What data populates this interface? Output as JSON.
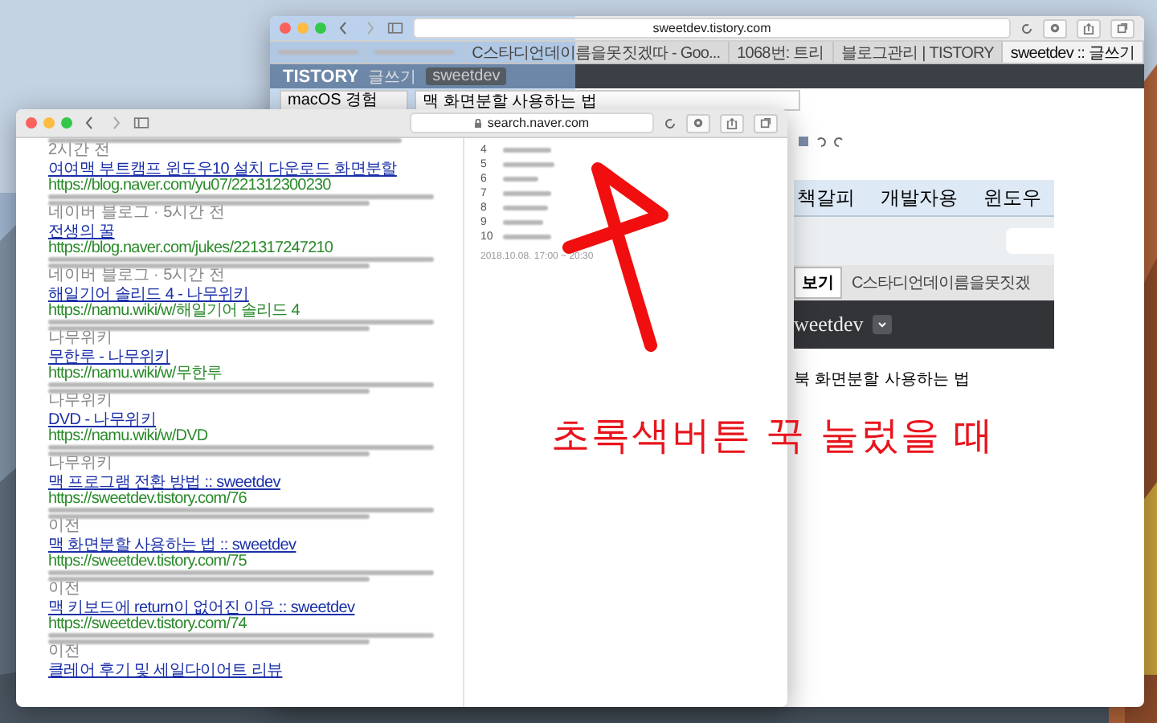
{
  "back_window": {
    "url": "sweetdev.tistory.com",
    "tabs": [
      {
        "selected": false
      },
      {
        "selected": false
      },
      {
        "label": "C스타디언데이름을못짓겠따 - Goo...",
        "selected": false
      },
      {
        "label": "1068번: 트리",
        "selected": false
      },
      {
        "label": "블로그관리 | TISTORY",
        "selected": false
      },
      {
        "label": "sweetdev :: 글쓰기",
        "selected": true
      }
    ],
    "blog_bar": {
      "logo": "TISTORY",
      "section": "글쓰기",
      "blog_chip": "sweetdev"
    },
    "category": "macOS 경험",
    "title_value": "맥 화면분할 사용하는 법",
    "embedded_screenshot": {
      "menu": [
        "책갈피",
        "개발자용",
        "윈도우"
      ],
      "tabs": [
        {
          "label": "보기",
          "selected": true
        },
        {
          "label": "C스타디언데이름을못짓겠",
          "selected": false
        }
      ],
      "blog_name": "weetdev",
      "post_title": "북 화면분할 사용하는 법"
    }
  },
  "front_window": {
    "url": "search.naver.com",
    "results": [
      {
        "source": "2시간 전"
      },
      {
        "title": "여여맥 부트캠프 윈도우10 설치 다운로드 화면분할",
        "url": "https://blog.naver.com/yu07/221312300230",
        "source": "네이버 블로그 · 5시간 전"
      },
      {
        "title": "전생의 꿀",
        "url": "https://blog.naver.com/jukes/221317247210",
        "source": "네이버 블로그 · 5시간 전"
      },
      {
        "title": "해일기어 솔리드 4 - 나무위키",
        "url": "https://namu.wiki/w/해일기어 솔리드 4",
        "source": "나무위키"
      },
      {
        "title": "무한루 - 나무위키",
        "url": "https://namu.wiki/w/무한루",
        "source": "나무위키"
      },
      {
        "title": "DVD - 나무위키",
        "url": "https://namu.wiki/w/DVD",
        "source": "나무위키"
      },
      {
        "title": "맥 프로그램 전환 방법 :: sweetdev",
        "url": "https://sweetdev.tistory.com/76",
        "source": "이전"
      },
      {
        "title": "맥 화면분할 사용하는 법 :: sweetdev",
        "url": "https://sweetdev.tistory.com/75",
        "source": "이전"
      },
      {
        "title": "맥 키보드에 return이 없어진 이유 :: sweetdev",
        "url": "https://sweetdev.tistory.com/74",
        "source": "이전"
      },
      {
        "title": "클레어 후기 및 세일다이어트 리뷰"
      }
    ],
    "ranking": {
      "items": [
        "4",
        "5",
        "6",
        "7",
        "8",
        "9",
        "10"
      ],
      "time": "2018.10.08. 17:00 ~ 20:30"
    }
  },
  "annotation": {
    "text": "초록색버튼 꾹 눌렀을 때"
  }
}
